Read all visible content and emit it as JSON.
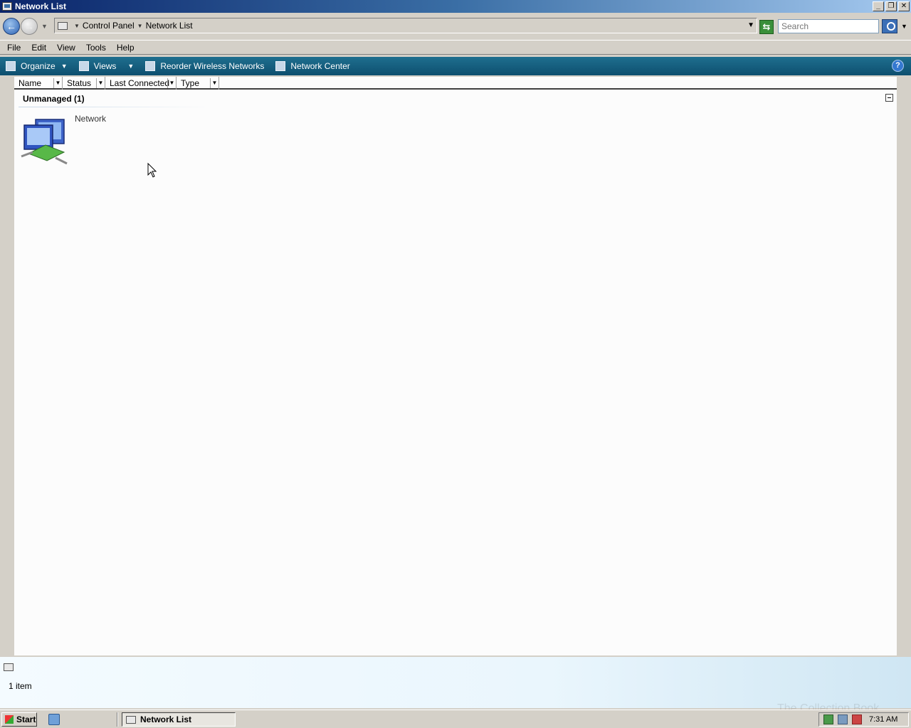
{
  "window": {
    "title": "Network List"
  },
  "address": {
    "breadcrumbs": [
      "Control Panel",
      "Network List"
    ],
    "search_placeholder": "Search"
  },
  "menu": {
    "items": [
      "File",
      "Edit",
      "View",
      "Tools",
      "Help"
    ]
  },
  "commands": {
    "organize": "Organize",
    "views": "Views",
    "reorder": "Reorder Wireless Networks",
    "network_center": "Network Center",
    "help": "?"
  },
  "columns": [
    "Name",
    "Status",
    "Last Connected",
    "Type"
  ],
  "group": {
    "title": "Unmanaged (1)",
    "items": [
      {
        "label": "Network"
      }
    ]
  },
  "details": {
    "count": "1 item"
  },
  "taskbar": {
    "start": "Start",
    "task": "Network List",
    "clock": "7:31 AM"
  },
  "watermark": "The Collection Book",
  "colors": {
    "command_bar": "#0d4f6f",
    "title_start": "#0a246a",
    "title_end": "#a6caf0"
  }
}
